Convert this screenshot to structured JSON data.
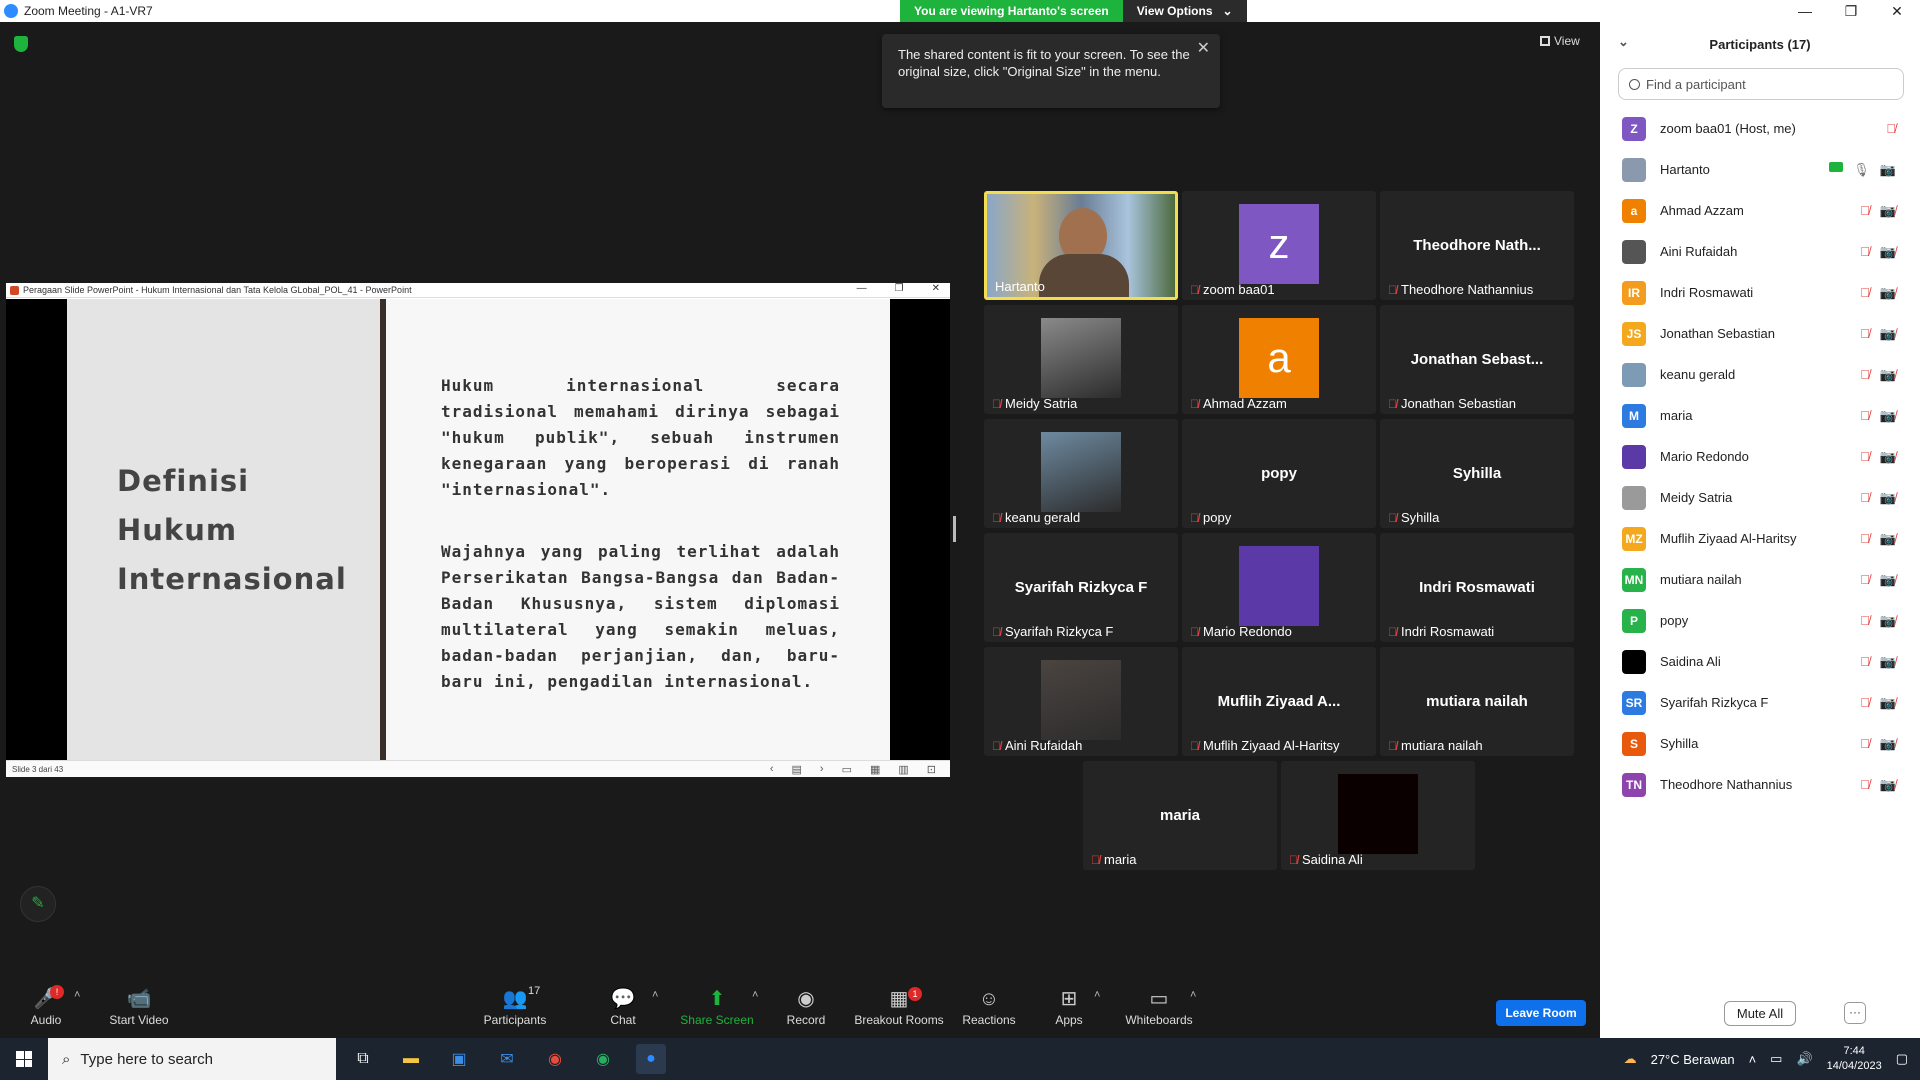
{
  "window": {
    "title": "Zoom Meeting - A1-VR7"
  },
  "banner": {
    "viewing": "You are viewing Hartanto's screen",
    "view_options": "View Options"
  },
  "tooltip": {
    "text": "The shared content is fit to your screen. To see the original size, click \"Original Size\" in the menu.",
    "close": "✕"
  },
  "view_button": {
    "label": "View"
  },
  "share": {
    "window_title": "Peragaan Slide PowerPoint  -  Hukum Internasional dan Tata Kelola GLobal_POL_41  -  PowerPoint",
    "slide_title": [
      "Definisi",
      "Hukum",
      "Internasional"
    ],
    "paragraphs": [
      "Hukum internasional secara tradisional memahami dirinya sebagai \"hukum publik\", sebuah instrumen kenegaraan yang beroperasi di ranah \"internasional\".",
      "Wajahnya yang paling terlihat adalah Perserikatan Bangsa-Bangsa dan Badan-Badan Khususnya, sistem diplomasi multilateral yang semakin meluas, badan-badan perjanjian, dan, baru-baru ini, pengadilan internasional."
    ],
    "status": "Slide 3 dari 43"
  },
  "tiles": [
    {
      "name": "Hartanto",
      "kind": "video",
      "active": true
    },
    {
      "name": "zoom baa01",
      "kind": "avatar",
      "letter": "z",
      "color": "#7e57c2"
    },
    {
      "name": "Theodhore Nathannius",
      "kind": "text",
      "big": "Theodhore Nath..."
    },
    {
      "name": "Meidy Satria",
      "kind": "photo",
      "color": "#8a8a8a"
    },
    {
      "name": "Ahmad Azzam",
      "kind": "avatar",
      "letter": "a",
      "color": "#f08000"
    },
    {
      "name": "Jonathan Sebastian",
      "kind": "text",
      "big": "Jonathan Sebast..."
    },
    {
      "name": "keanu gerald",
      "kind": "photo",
      "color": "#6e8aa0"
    },
    {
      "name": "popy",
      "kind": "text",
      "big": "popy"
    },
    {
      "name": "Syhilla",
      "kind": "text",
      "big": "Syhilla"
    },
    {
      "name": "Syarifah Rizkyca F",
      "kind": "text",
      "big": "Syarifah Rizkyca F"
    },
    {
      "name": "Mario Redondo",
      "kind": "avatar",
      "letter": "",
      "color": "#5b3aa8"
    },
    {
      "name": "Indri Rosmawati",
      "kind": "text",
      "big": "Indri Rosmawati"
    },
    {
      "name": "Aini Rufaidah",
      "kind": "photo",
      "color": "#4b4440"
    },
    {
      "name": "Muflih Ziyaad Al-Haritsy",
      "kind": "text",
      "big": "Muflih Ziyaad A..."
    },
    {
      "name": "mutiara nailah",
      "kind": "text",
      "big": "mutiara nailah"
    },
    {
      "name": "maria",
      "kind": "text",
      "big": "maria"
    },
    {
      "name": "Saidina Ali",
      "kind": "avatar",
      "letter": "",
      "color": "#0a0000"
    }
  ],
  "panel": {
    "title": "Participants (17)",
    "search_placeholder": "Find a participant",
    "participants": [
      {
        "initials": "Z",
        "color": "#7e57c2",
        "name": "zoom baa01 (Host, me)",
        "mic": "muted",
        "cam": ""
      },
      {
        "initials": "",
        "color": "#8a99ad",
        "name": "Hartanto",
        "mic": "on",
        "cam": "on",
        "sharing": true
      },
      {
        "initials": "a",
        "color": "#f08000",
        "name": "Ahmad Azzam",
        "mic": "muted",
        "cam": "off"
      },
      {
        "initials": "",
        "color": "#555555",
        "name": "Aini Rufaidah",
        "mic": "muted",
        "cam": "off"
      },
      {
        "initials": "IR",
        "color": "#f39c1e",
        "name": "Indri Rosmawati",
        "mic": "muted",
        "cam": "off"
      },
      {
        "initials": "JS",
        "color": "#f3a81e",
        "name": "Jonathan Sebastian",
        "mic": "muted",
        "cam": "off"
      },
      {
        "initials": "",
        "color": "#7e9bb5",
        "name": "keanu gerald",
        "mic": "muted",
        "cam": "off"
      },
      {
        "initials": "M",
        "color": "#2d7be0",
        "name": "maria",
        "mic": "muted",
        "cam": "off"
      },
      {
        "initials": "",
        "color": "#5b3aa8",
        "name": "Mario Redondo",
        "mic": "muted",
        "cam": "off"
      },
      {
        "initials": "",
        "color": "#9a9a9a",
        "name": "Meidy Satria",
        "mic": "muted",
        "cam": "off"
      },
      {
        "initials": "MZ",
        "color": "#f3a81e",
        "name": "Muflih Ziyaad Al-Haritsy",
        "mic": "muted",
        "cam": "off"
      },
      {
        "initials": "MN",
        "color": "#27b34a",
        "name": "mutiara nailah",
        "mic": "muted",
        "cam": "off"
      },
      {
        "initials": "P",
        "color": "#27b34a",
        "name": "popy",
        "mic": "muted",
        "cam": "off"
      },
      {
        "initials": "",
        "color": "#000000",
        "name": "Saidina Ali",
        "mic": "muted",
        "cam": "off"
      },
      {
        "initials": "SR",
        "color": "#2d7be0",
        "name": "Syarifah Rizkyca F",
        "mic": "muted",
        "cam": "off"
      },
      {
        "initials": "S",
        "color": "#e8590c",
        "name": "Syhilla",
        "mic": "muted",
        "cam": "off"
      },
      {
        "initials": "TN",
        "color": "#8e44ad",
        "name": "Theodhore Nathannius",
        "mic": "muted",
        "cam": "off"
      }
    ],
    "mute_all": "Mute All",
    "more": "···"
  },
  "toolbar": {
    "audio": "Audio",
    "start_video": "Start Video",
    "participants": "Participants",
    "participants_count": "17",
    "chat": "Chat",
    "share_screen": "Share Screen",
    "record": "Record",
    "breakout": "Breakout Rooms",
    "breakout_badge": "1",
    "reactions": "Reactions",
    "apps": "Apps",
    "whiteboards": "Whiteboards",
    "leave": "Leave Room",
    "audio_badge": "!"
  },
  "taskbar": {
    "search_placeholder": "Type here to search",
    "weather": "27°C  Berawan",
    "time": "7:44",
    "date": "14/04/2023"
  }
}
